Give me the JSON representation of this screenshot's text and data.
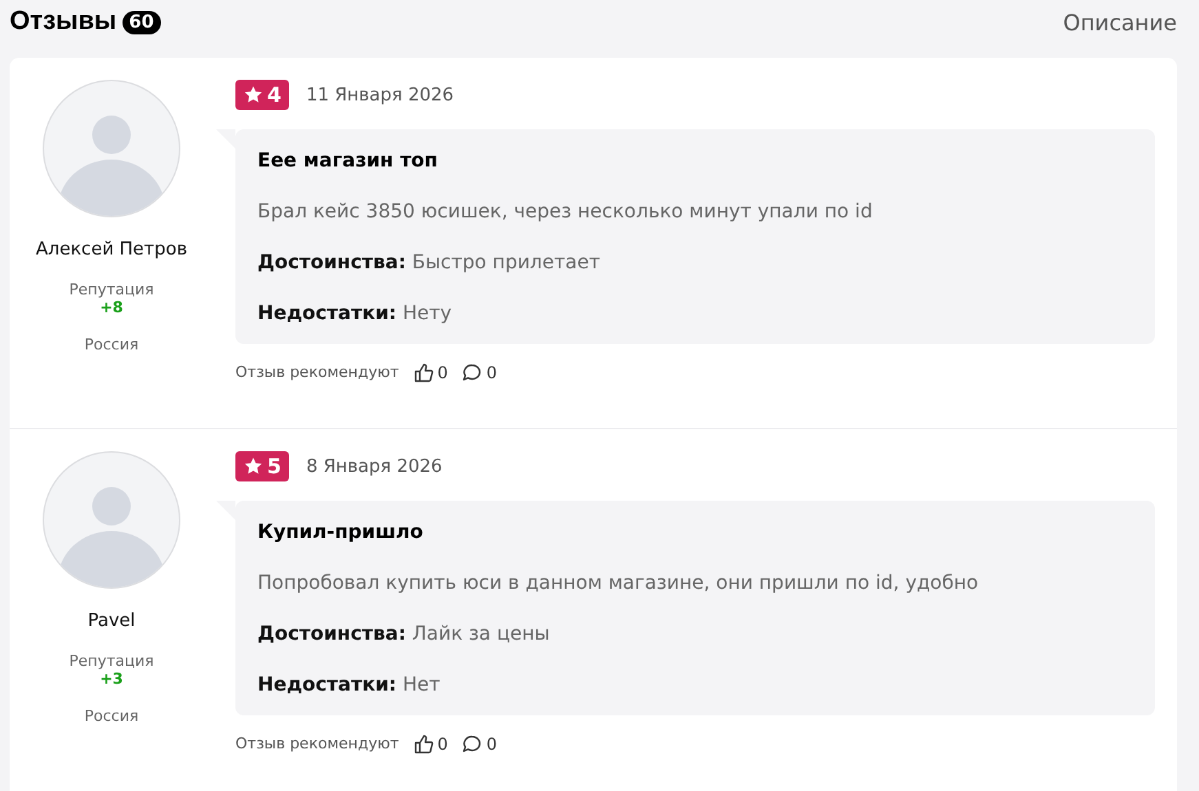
{
  "header": {
    "title": "Отзывы",
    "count": "60",
    "description_link": "Описание"
  },
  "reviews": [
    {
      "author": "Алексей Петров",
      "reputation_label": "Репутация",
      "reputation": "+8",
      "country": "Россия",
      "rating": "4",
      "date": "11 Января 2026",
      "title": "Еее магазин топ",
      "text": "Брал кейс 3850 юсишек, через несколько минут упали по id",
      "pros_label": "Достоинства:",
      "pros": "Быстро прилетает",
      "cons_label": "Недостатки:",
      "cons": "Нету",
      "recommend_label": "Отзыв рекомендуют",
      "likes": "0",
      "comments": "0"
    },
    {
      "author": "Pavel",
      "reputation_label": "Репутация",
      "reputation": "+3",
      "country": "Россия",
      "rating": "5",
      "date": "8 Января 2026",
      "title": "Купил-пришло",
      "text": "Попробовал купить юси в данном магазине, они пришли по id, удобно",
      "pros_label": "Достоинства:",
      "pros": "Лайк за цены",
      "cons_label": "Недостатки:",
      "cons": "Нет",
      "recommend_label": "Отзыв рекомендуют",
      "likes": "0",
      "comments": "0"
    }
  ]
}
